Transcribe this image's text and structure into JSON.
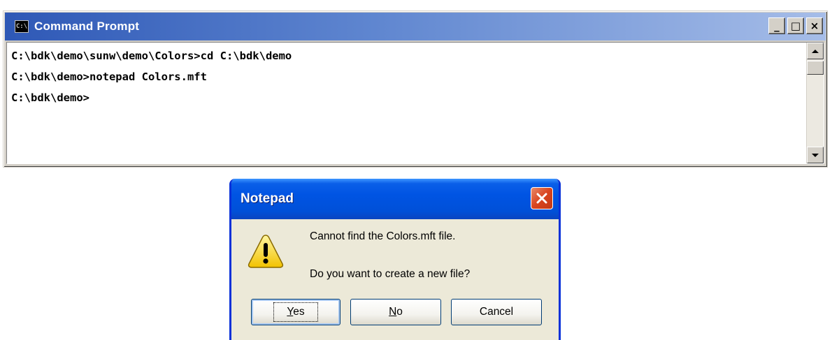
{
  "cmd": {
    "title": "Command Prompt",
    "icon": "console-icon",
    "icon_label": "C:\\",
    "controls": {
      "minimize": "_",
      "maximize": "□",
      "close": "×"
    },
    "lines": [
      "C:\\bdk\\demo\\sunw\\demo\\Colors>cd C:\\bdk\\demo",
      "C:\\bdk\\demo>notepad Colors.mft",
      "C:\\bdk\\demo>"
    ]
  },
  "dialog": {
    "title": "Notepad",
    "icon": "warning-icon",
    "message": "Cannot find the Colors.mft file.",
    "question": "Do you want to create a new file?",
    "buttons": {
      "yes_mnemonic": "Y",
      "yes_rest": "es",
      "no_mnemonic": "N",
      "no_rest": "o",
      "cancel": "Cancel"
    }
  },
  "colors": {
    "xp_title_blue": "#0054e3",
    "xp_close_red": "#d9441f",
    "dialog_face": "#ece9d8",
    "classic_face": "#d4d0c8"
  }
}
